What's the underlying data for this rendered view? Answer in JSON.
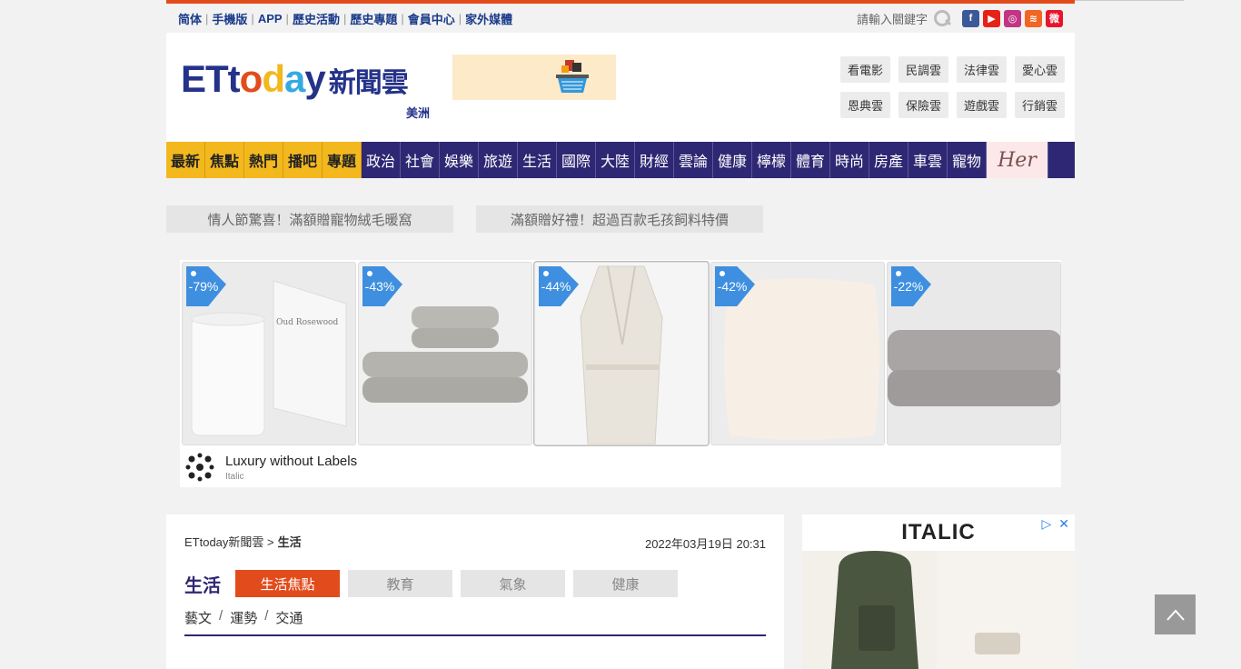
{
  "topbar": {
    "links": [
      "简体",
      "手機版",
      "APP",
      "歷史活動",
      "歷史專題",
      "會員中心",
      "家外媒體"
    ],
    "search_placeholder": "請輸入關鍵字",
    "social": [
      {
        "name": "facebook",
        "glyph": "f",
        "color": "#3b5998"
      },
      {
        "name": "youtube",
        "glyph": "▶",
        "color": "#e62117"
      },
      {
        "name": "instagram",
        "glyph": "◎",
        "color": "#c13584"
      },
      {
        "name": "rss",
        "glyph": "≋",
        "color": "#f26522"
      },
      {
        "name": "weibo",
        "glyph": "微",
        "color": "#e6162d"
      }
    ]
  },
  "header": {
    "logo": {
      "et": "ET",
      "t": "t",
      "o1": "o",
      "d": "d",
      "a": "a",
      "y": "y",
      "cn": "新聞雲"
    },
    "region": "美洲",
    "clouds": [
      "看電影",
      "民調雲",
      "法律雲",
      "愛心雲",
      "恩典雲",
      "保險雲",
      "遊戲雲",
      "行銷雲"
    ]
  },
  "nav": {
    "hot": [
      "最新",
      "焦點",
      "熱門",
      "播吧",
      "專題"
    ],
    "items": [
      "政治",
      "社會",
      "娛樂",
      "旅遊",
      "生活",
      "國際",
      "大陸",
      "財經",
      "雲論",
      "健康",
      "檸檬",
      "體育",
      "時尚",
      "房產",
      "車雲",
      "寵物"
    ],
    "her": "Her"
  },
  "promos": [
    "情人節驚喜！滿額贈寵物絨毛暖窩",
    "滿額贈好禮！超過百款毛孩飼料特價"
  ],
  "ad": {
    "products": [
      {
        "discount": "-79%",
        "kind": "candle",
        "label": "Oud Rosewood"
      },
      {
        "discount": "-43%",
        "kind": "towels"
      },
      {
        "discount": "-44%",
        "kind": "robe"
      },
      {
        "discount": "-42%",
        "kind": "pillow"
      },
      {
        "discount": "-22%",
        "kind": "blanket"
      }
    ],
    "title": "Luxury without Labels",
    "brand": "Italic",
    "controls": {
      "adchoices": "▷",
      "close": "✕"
    }
  },
  "article": {
    "breadcrumb_home": "ETtoday新聞雲 >",
    "breadcrumb_current": "生活",
    "date": "2022年03月19日 20:31",
    "category": "生活",
    "tabs": [
      "生活焦點",
      "教育",
      "氣象",
      "健康"
    ],
    "subcats": [
      "藝文",
      "運勢",
      "交通"
    ]
  },
  "sidead": {
    "brand": "ITALIC"
  },
  "colors": {
    "brand_blue": "#2e2773",
    "accent_orange": "#e24c1d",
    "hot_yellow": "#f3b81e"
  }
}
